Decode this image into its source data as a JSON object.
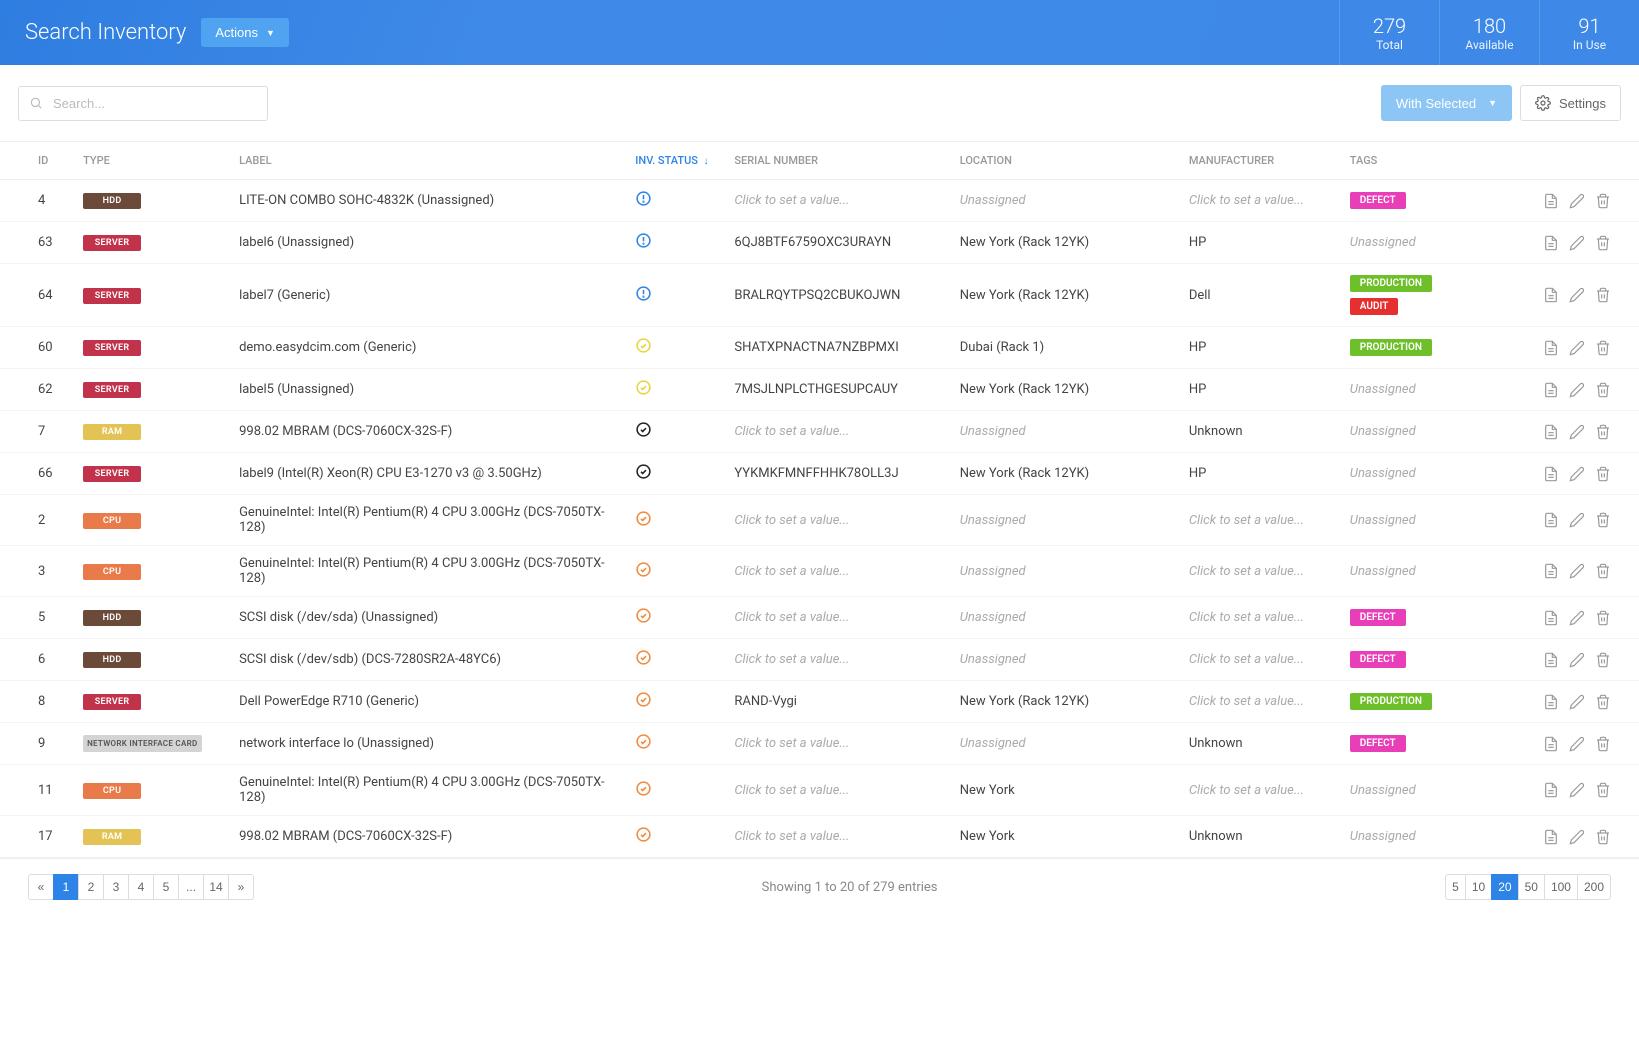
{
  "header": {
    "title": "Search Inventory",
    "actions_label": "Actions",
    "stats": [
      {
        "num": "279",
        "label": "Total"
      },
      {
        "num": "180",
        "label": "Available"
      },
      {
        "num": "91",
        "label": "In Use"
      }
    ]
  },
  "toolbar": {
    "search_placeholder": "Search...",
    "with_selected_label": "With Selected",
    "settings_label": "Settings"
  },
  "columns": {
    "id": "ID",
    "type": "TYPE",
    "label": "LABEL",
    "inv_status": "INV. STATUS",
    "serial": "SERIAL NUMBER",
    "location": "LOCATION",
    "manufacturer": "MANUFACTURER",
    "tags": "TAGS"
  },
  "placeholders": {
    "click_value": "Click to set a value...",
    "unassigned": "Unassigned"
  },
  "rows": [
    {
      "id": "4",
      "type": "HDD",
      "type_class": "t-hdd",
      "label": "LITE-ON COMBO SOHC-4832K (Unassigned)",
      "status": "blue-alert",
      "serial": null,
      "location": null,
      "manufacturer": null,
      "tags": [
        "DEFECT"
      ]
    },
    {
      "id": "63",
      "type": "SERVER",
      "type_class": "t-server",
      "label": "label6 (Unassigned)",
      "status": "blue-alert",
      "serial": "6QJ8BTF6759OXC3URAYN",
      "location": "New York (Rack 12YK)",
      "manufacturer": "HP",
      "tags": []
    },
    {
      "id": "64",
      "type": "SERVER",
      "type_class": "t-server",
      "label": "label7 (Generic)",
      "status": "blue-alert",
      "serial": "BRALRQYTPSQ2CBUKOJWN",
      "location": "New York (Rack 12YK)",
      "manufacturer": "Dell",
      "tags": [
        "PRODUCTION",
        "AUDIT"
      ]
    },
    {
      "id": "60",
      "type": "SERVER",
      "type_class": "t-server",
      "label": "demo.easydcim.com (Generic)",
      "status": "yellow-check",
      "serial": "SHATXPNACTNA7NZBPMXI",
      "location": "Dubai (Rack 1)",
      "manufacturer": "HP",
      "tags": [
        "PRODUCTION"
      ]
    },
    {
      "id": "62",
      "type": "SERVER",
      "type_class": "t-server",
      "label": "label5 (Unassigned)",
      "status": "yellow-check",
      "serial": "7MSJLNPLCTHGESUPCAUY",
      "location": "New York (Rack 12YK)",
      "manufacturer": "HP",
      "tags": []
    },
    {
      "id": "7",
      "type": "RAM",
      "type_class": "t-ram",
      "label": "998.02 MBRAM (DCS-7060CX-32S-F)",
      "status": "black-check",
      "serial": null,
      "location": null,
      "manufacturer": "Unknown",
      "tags": []
    },
    {
      "id": "66",
      "type": "SERVER",
      "type_class": "t-server",
      "label": "label9 (Intel(R) Xeon(R) CPU E3-1270 v3 @ 3.50GHz)",
      "status": "black-check",
      "serial": "YYKMKFMNFFHHK78OLL3J",
      "location": "New York (Rack 12YK)",
      "manufacturer": "HP",
      "tags": []
    },
    {
      "id": "2",
      "type": "CPU",
      "type_class": "t-cpu",
      "label": "GenuineIntel: Intel(R) Pentium(R) 4 CPU 3.00GHz (DCS-7050TX-128)",
      "status": "orange-check",
      "serial": null,
      "location": null,
      "manufacturer": null,
      "tags": []
    },
    {
      "id": "3",
      "type": "CPU",
      "type_class": "t-cpu",
      "label": "GenuineIntel: Intel(R) Pentium(R) 4 CPU 3.00GHz (DCS-7050TX-128)",
      "status": "orange-check",
      "serial": null,
      "location": null,
      "manufacturer": null,
      "tags": []
    },
    {
      "id": "5",
      "type": "HDD",
      "type_class": "t-hdd",
      "label": "SCSI disk (/dev/sda) (Unassigned)",
      "status": "orange-check",
      "serial": null,
      "location": null,
      "manufacturer": null,
      "tags": [
        "DEFECT"
      ]
    },
    {
      "id": "6",
      "type": "HDD",
      "type_class": "t-hdd",
      "label": "SCSI disk (/dev/sdb) (DCS-7280SR2A-48YC6)",
      "status": "orange-check",
      "serial": null,
      "location": null,
      "manufacturer": null,
      "tags": [
        "DEFECT"
      ]
    },
    {
      "id": "8",
      "type": "SERVER",
      "type_class": "t-server",
      "label": "Dell PowerEdge R710 (Generic)",
      "status": "orange-check",
      "serial": "RAND-Vygi",
      "location": "New York (Rack 12YK)",
      "manufacturer": null,
      "tags": [
        "PRODUCTION"
      ]
    },
    {
      "id": "9",
      "type": "NETWORK INTERFACE CARD",
      "type_class": "t-nic",
      "label": "network interface lo (Unassigned)",
      "status": "orange-check",
      "serial": null,
      "location": null,
      "manufacturer": "Unknown",
      "tags": [
        "DEFECT"
      ]
    },
    {
      "id": "11",
      "type": "CPU",
      "type_class": "t-cpu",
      "label": "GenuineIntel: Intel(R) Pentium(R) 4 CPU 3.00GHz (DCS-7050TX-128)",
      "status": "orange-check",
      "serial": null,
      "location": "New York",
      "manufacturer": null,
      "tags": []
    },
    {
      "id": "17",
      "type": "RAM",
      "type_class": "t-ram",
      "label": "998.02 MBRAM (DCS-7060CX-32S-F)",
      "status": "orange-check",
      "serial": null,
      "location": "New York",
      "manufacturer": "Unknown",
      "tags": []
    }
  ],
  "tag_styles": {
    "DEFECT": "tag-defect",
    "PRODUCTION": "tag-prod",
    "AUDIT": "tag-audit"
  },
  "footer": {
    "showing": "Showing 1 to 20 of 279 entries",
    "pages": [
      "1",
      "2",
      "3",
      "4",
      "5",
      "...",
      "14"
    ],
    "active_page": "1",
    "page_sizes": [
      "5",
      "10",
      "20",
      "50",
      "100",
      "200"
    ],
    "active_size": "20"
  }
}
